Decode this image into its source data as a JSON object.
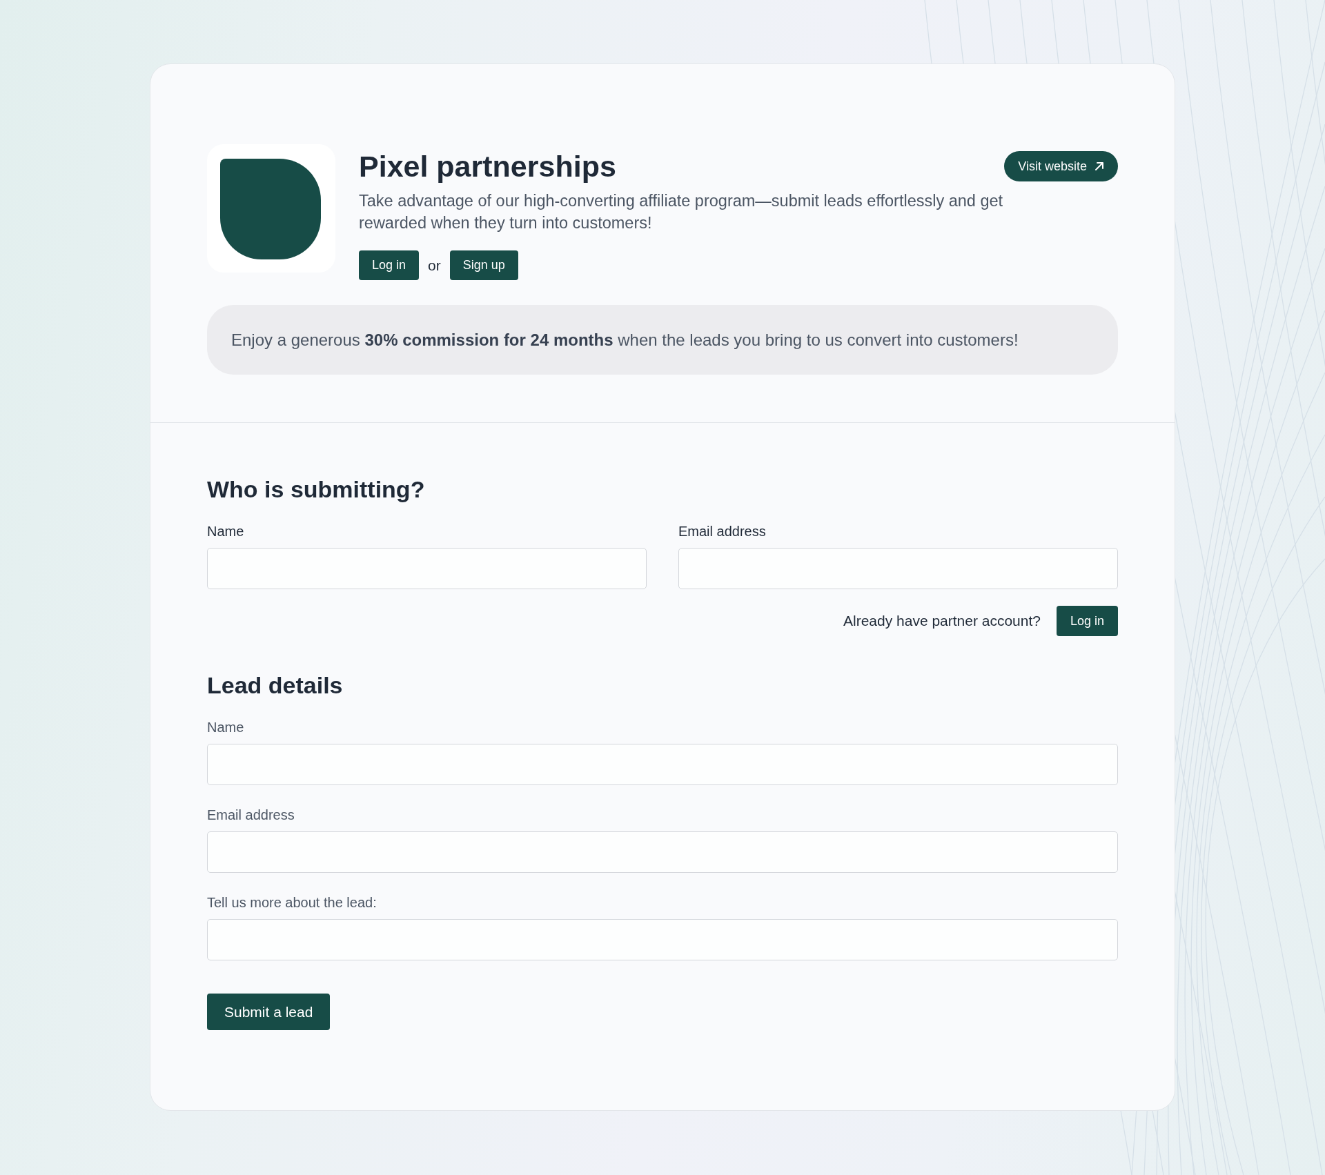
{
  "program": {
    "name": "Pixel partnerships",
    "website_button": "Visit website",
    "description": "Take advantage of our high-converting affiliate program—submit leads effortlessly and get rewarded when they turn into customers!",
    "login_button": "Log in",
    "separator": "or",
    "signup_button": "Sign up"
  },
  "commission_banner": {
    "text": "Enjoy a generous **30% commission for 24 months** when the leads you bring to us convert into customers!"
  },
  "submitter": {
    "heading": "Who is submitting?",
    "fields": [
      {
        "label": "Name"
      },
      {
        "label": "Email address"
      }
    ],
    "account_prompt": "Already have partner account?",
    "login_button": "Log in"
  },
  "lead": {
    "heading": "Lead details",
    "fields": [
      {
        "label": "Name"
      },
      {
        "label": "Email address"
      },
      {
        "label": "Tell us more about the lead:"
      }
    ],
    "submit_button": "Submit a lead"
  }
}
